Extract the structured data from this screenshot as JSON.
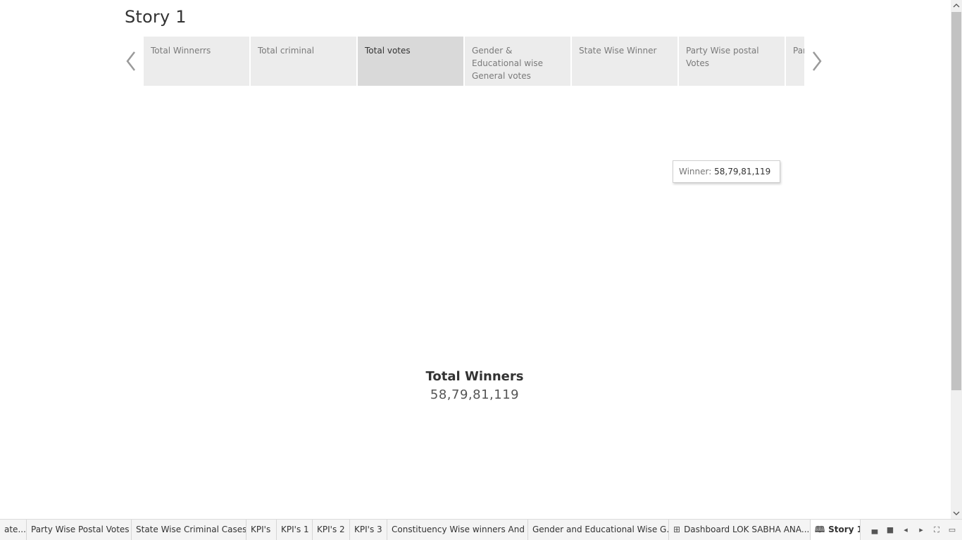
{
  "story": {
    "title": "Story 1",
    "points": [
      {
        "label": "Total Winnerrs"
      },
      {
        "label": "Total criminal"
      },
      {
        "label": "Total votes"
      },
      {
        "label": "Gender & Educational wise General votes"
      },
      {
        "label": "State Wise Winner"
      },
      {
        "label": "Party Wise postal Votes"
      },
      {
        "label": "Par"
      }
    ],
    "active_index": 2
  },
  "tooltip": {
    "label": "Winner:",
    "value": "58,79,81,119"
  },
  "kpi": {
    "title": "Total Winners",
    "value": "58,79,81,119"
  },
  "sheet_tabs": [
    {
      "label": "ate...",
      "icon": ""
    },
    {
      "label": "Party Wise Postal Votes",
      "icon": ""
    },
    {
      "label": "State Wise Criminal Cases",
      "icon": ""
    },
    {
      "label": "KPI's",
      "icon": ""
    },
    {
      "label": "KPI's 1",
      "icon": ""
    },
    {
      "label": "KPI's 2",
      "icon": ""
    },
    {
      "label": "KPI's 3",
      "icon": ""
    },
    {
      "label": "Constituency Wise winners And ...",
      "icon": ""
    },
    {
      "label": "Gender and Educational Wise G...",
      "icon": ""
    },
    {
      "label": "Dashboard LOK SABHA ANA...",
      "icon": "dashboard-icon"
    },
    {
      "label": "Story 1",
      "icon": "story-icon"
    }
  ],
  "icons": {
    "prev": "chevron-left-icon",
    "next": "chevron-right-icon",
    "dashboard": "dashboard-grid-icon",
    "story": "story-book-icon"
  },
  "colors": {
    "active_point_bg": "#d9d9d9",
    "point_bg": "#ececec",
    "scroll_thumb": "#c2c2c2"
  }
}
